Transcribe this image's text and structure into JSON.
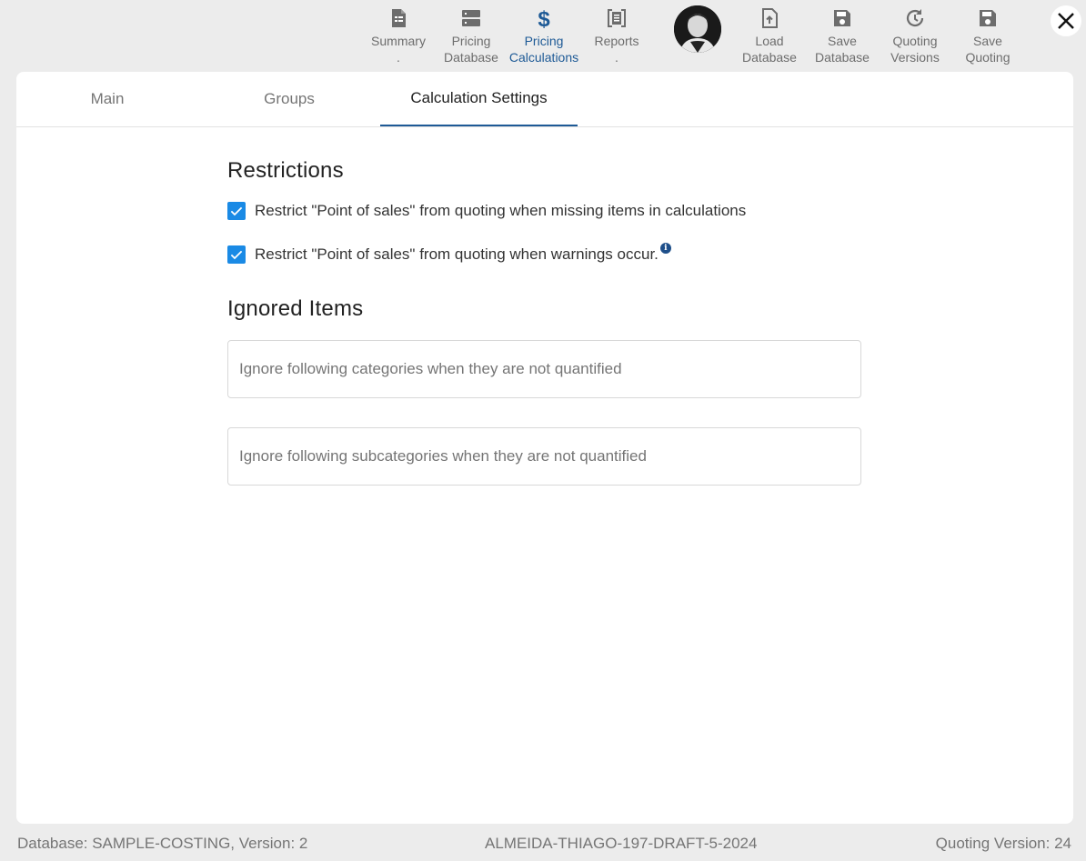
{
  "toolbar": {
    "items": [
      {
        "line1": "Summary",
        "line2": ".",
        "icon": "document-icon"
      },
      {
        "line1": "Pricing",
        "line2": "Database",
        "icon": "database-icon"
      },
      {
        "line1": "Pricing",
        "line2": "Calculations",
        "icon": "dollar-icon",
        "active": true
      },
      {
        "line1": "Reports",
        "line2": ".",
        "icon": "report-icon"
      },
      {
        "line1": "Load",
        "line2": "Database",
        "icon": "file-upload-icon"
      },
      {
        "line1": "Save",
        "line2": "Database",
        "icon": "floppy-icon"
      },
      {
        "line1": "Quoting",
        "line2": "Versions",
        "icon": "history-icon"
      },
      {
        "line1": "Save",
        "line2": "Quoting",
        "icon": "floppy-icon"
      }
    ],
    "accent_color": "#1e5a96"
  },
  "tabs": [
    {
      "label": "Main"
    },
    {
      "label": "Groups"
    },
    {
      "label": "Calculation Settings",
      "active": true
    }
  ],
  "restrictions": {
    "title": "Restrictions",
    "options": [
      {
        "label": "Restrict \"Point of sales\" from quoting when missing items in calculations",
        "checked": true
      },
      {
        "label": "Restrict \"Point of sales\" from quoting when warnings occur.",
        "checked": true,
        "info": "i"
      }
    ]
  },
  "ignored": {
    "title": "Ignored Items",
    "categories_placeholder": "Ignore following categories when they are not quantified",
    "subcategories_placeholder": "Ignore following subcategories when they are not quantified"
  },
  "footer": {
    "database": "Database: SAMPLE-COSTING, Version: 2",
    "quote_id": "ALMEIDA-THIAGO-197-DRAFT-5-2024",
    "quoting_version": "Quoting Version: 24"
  }
}
